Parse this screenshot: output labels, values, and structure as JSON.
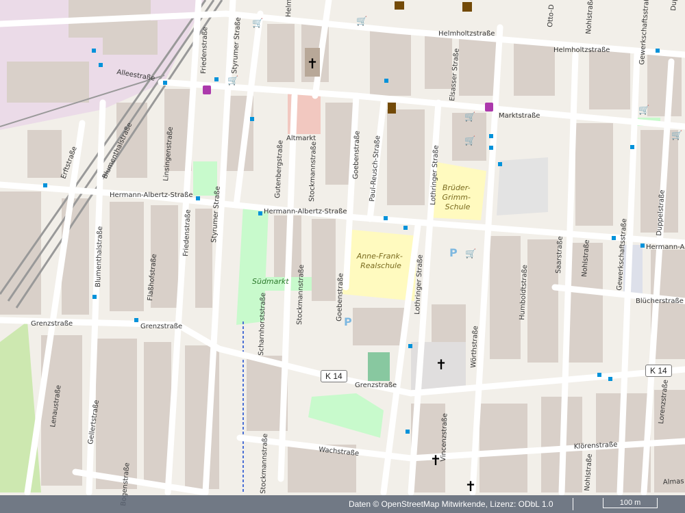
{
  "map": {
    "streets": {
      "helmholtz_1": "Helmholtzstraße",
      "helmholtz_2": "Helmholtzstraße",
      "allee": "Alleestraße",
      "markt": "Marktstraße",
      "altmarkt": "Altmarkt",
      "erft": "Erftstraße",
      "blumenthal_1": "Blumenthalstraße",
      "blumenthal_2": "Blumenthalstraße",
      "linsingen": "Linsingenstraße",
      "friedens_1": "Friedenstraße",
      "friedens_2": "Friedenstraße",
      "styrumer_1": "Styrumer Straße",
      "styrumer_2": "Styrumer Straße",
      "gutenberg": "Gutenbergstraße",
      "stockmann_1": "Stockmannstraße",
      "stockmann_2": "Stockmannstraße",
      "stockmann_3": "Stockmannstraße",
      "goeben_1": "Goebenstraße",
      "goeben_2": "Goebenstraße",
      "paul_reusch": "Paul-Reusch-Straße",
      "lothringer_1": "Lothringer Straße",
      "lothringer_2": "Lothringer Straße",
      "elsasser": "Elsasser Straße",
      "hermann_albertz_1": "Hermann-Albertz-Straße",
      "hermann_albertz_2": "Hermann-Albertz-Straße",
      "hermann_albertz_3": "Hermann-A",
      "flasshof": "Flaßhofstraße",
      "grenz_1": "Grenzstraße",
      "grenz_2": "Grenzstraße",
      "grenz_3": "Grenzstraße",
      "scharnhorst": "Scharnhorststraße",
      "woerth": "Wörthstraße",
      "humboldt": "Humboldtstraße",
      "saar": "Saarstraße",
      "nohl_1": "Nohlstraße",
      "nohl_2": "Nohlstraße",
      "nohl_3": "Nohlstraße",
      "gewerkschafts_1": "Gewerkschaftsstraße",
      "gewerkschafts_2": "Gewerkschaftsstraße",
      "duppel_1": "Duppelstraße",
      "duppel_2": "Duppelstraße",
      "blucher": "Blücherstraße",
      "lenau": "Lenaustraße",
      "geller": "Gellertstraße",
      "bogen": "Bogenstraße",
      "wach": "Wachstraße",
      "vincenz": "Vincenzstraße",
      "kloren": "Klörenstraße",
      "lorenz": "Lorenzstraße",
      "helm_top": "Helm",
      "otto": "Otto-D",
      "almas": "Almas"
    },
    "pois": {
      "school_1": "Brüder-\nGrimm-\nSchule",
      "school_2": "Anne-Frank-\nRealschule",
      "suedmarkt": "Südmarkt"
    },
    "road_refs": [
      "K 14",
      "K 14"
    ],
    "attribution": "Daten © OpenStreetMap Mitwirkende, Lizenz: ODbL 1.0",
    "scale_label": "100 m",
    "colors": {
      "background": "#f2efe9",
      "building": "#d9d0c9",
      "road": "#ffffff",
      "park": "#c8facc",
      "school": "#fffabf",
      "parking": "#eeeeee",
      "rail": "#999999"
    }
  }
}
